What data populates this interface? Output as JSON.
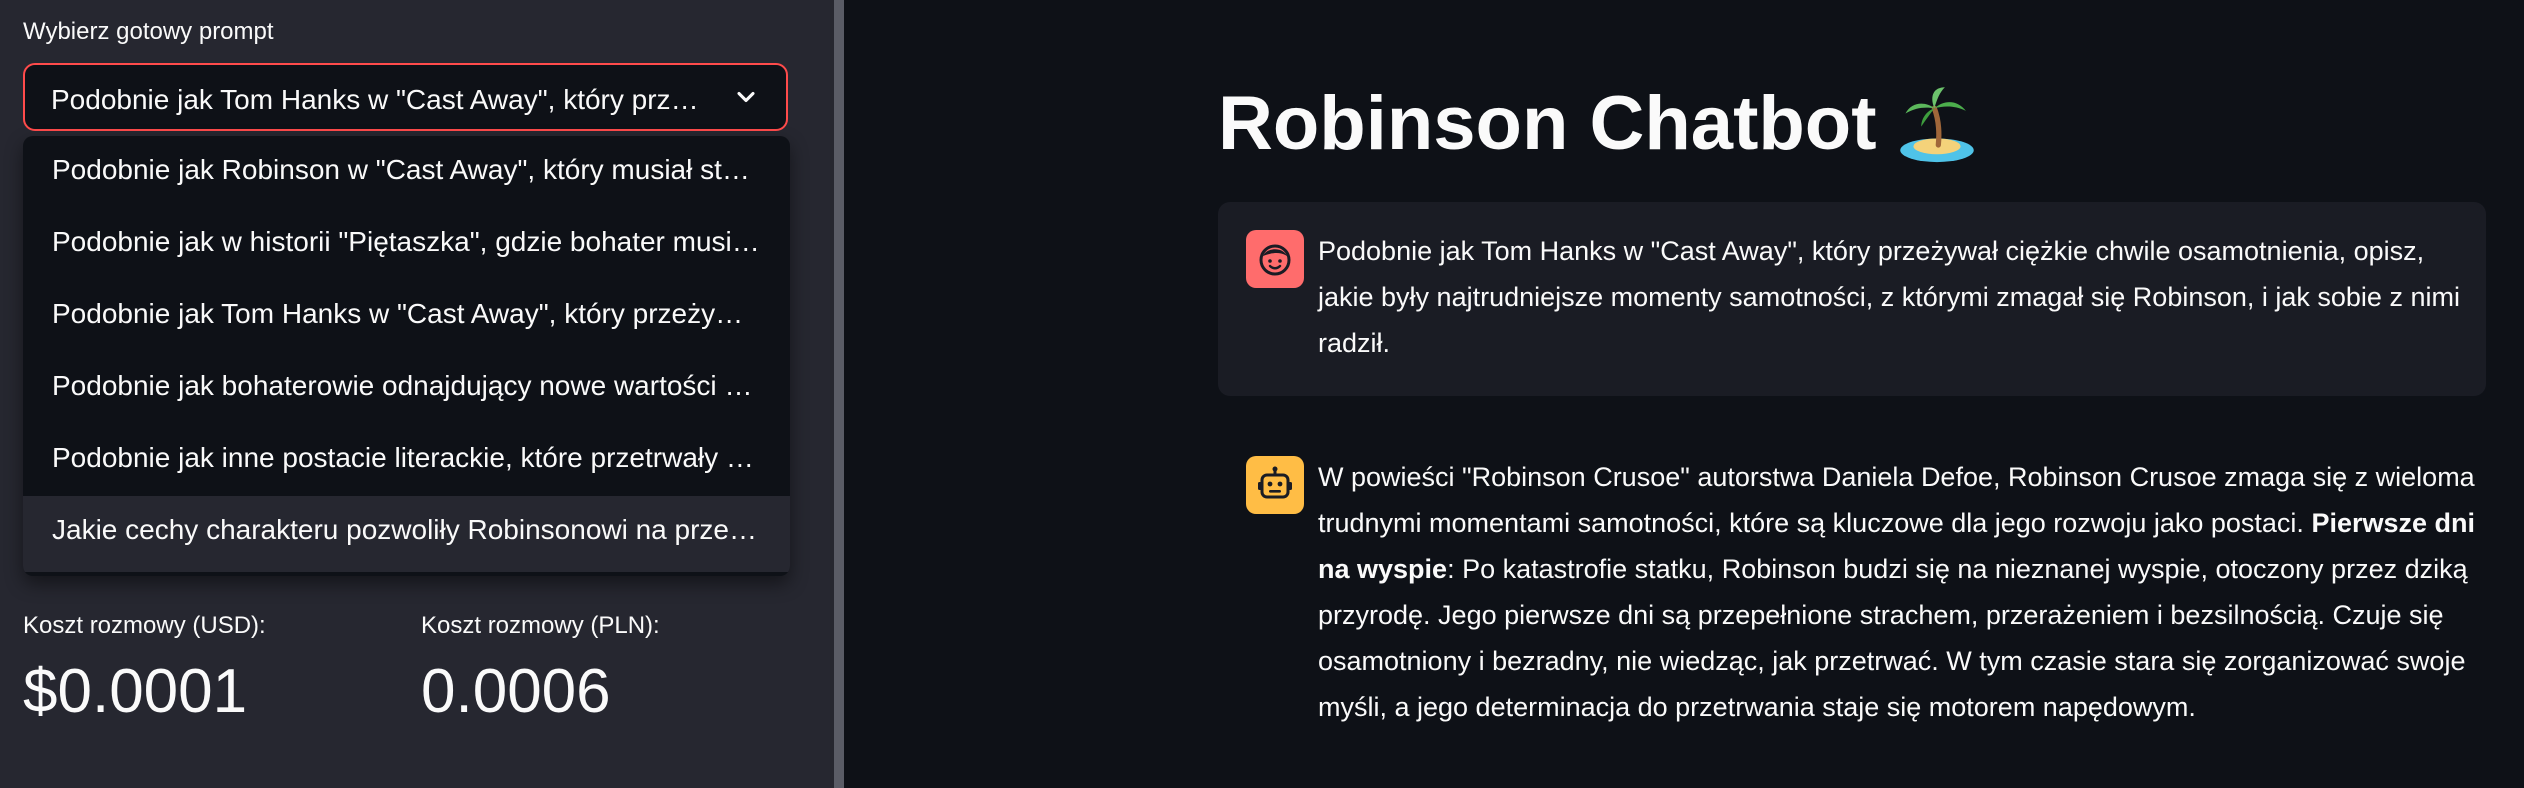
{
  "sidebar": {
    "select_label": "Wybierz gotowy prompt",
    "selected_value": "Podobnie jak Tom Hanks w \"Cast Away\", który przeżywał ciężkie chwile osamotnienia, opisz, jakie były najtrudniejsze momenty samotności",
    "options": [
      "Podobnie jak Robinson w \"Cast Away\", który musiał stworzyć sobie towarzysza",
      "Podobnie jak w historii \"Piętaszka\", gdzie bohater musiał nauczyć się",
      "Podobnie jak Tom Hanks w \"Cast Away\", który przeżywał ciężkie chwile",
      "Podobnie jak bohaterowie odnajdujący nowe wartości po katastrofie",
      "Podobnie jak inne postacie literackie, które przetrwały samotność",
      "Jakie cechy charakteru pozwoliły Robinsonowi na przetrwanie"
    ],
    "highlighted_index": 5,
    "metrics": {
      "usd": {
        "label": "Koszt rozmowy (USD):",
        "value": "$0.0001"
      },
      "pln": {
        "label": "Koszt rozmowy (PLN):",
        "value": "0.0006"
      }
    }
  },
  "main": {
    "title": "Robinson Chatbot",
    "title_icon": "palm-island-icon",
    "messages": [
      {
        "role": "user",
        "avatar_icon": "user-face-icon",
        "text": "Podobnie jak Tom Hanks w \"Cast Away\", który przeżywał ciężkie chwile osamotnienia, opisz, jakie były najtrudniejsze momenty samotności, z którymi zmagał się Robinson, i jak sobie z nimi radził."
      },
      {
        "role": "assistant",
        "avatar_icon": "robot-face-icon",
        "text_before": "W powieści \"Robinson Crusoe\" autorstwa Daniela Defoe, Robinson Crusoe zmaga się z wieloma trudnymi momentami samotności, które są kluczowe dla jego rozwoju jako postaci. ",
        "bold": "Pierwsze dni na wyspie",
        "text_after": ": Po katastrofie statku, Robinson budzi się na nieznanej wyspie, otoczony przez dziką przyrodę. Jego pierwsze dni są przepełnione strachem, przerażeniem i bezsilnością. Czuje się osamotniony i bezradny, nie wiedząc, jak przetrwać. W tym czasie stara się zorganizować swoje myśli, a jego determinacja do przetrwania staje się motorem napędowym."
      }
    ]
  },
  "colors": {
    "background": "#0e1117",
    "sidebar": "#262730",
    "accent": "#ff4b4b",
    "user_avatar": "#ff6c6c",
    "bot_avatar": "#ffbd45"
  }
}
